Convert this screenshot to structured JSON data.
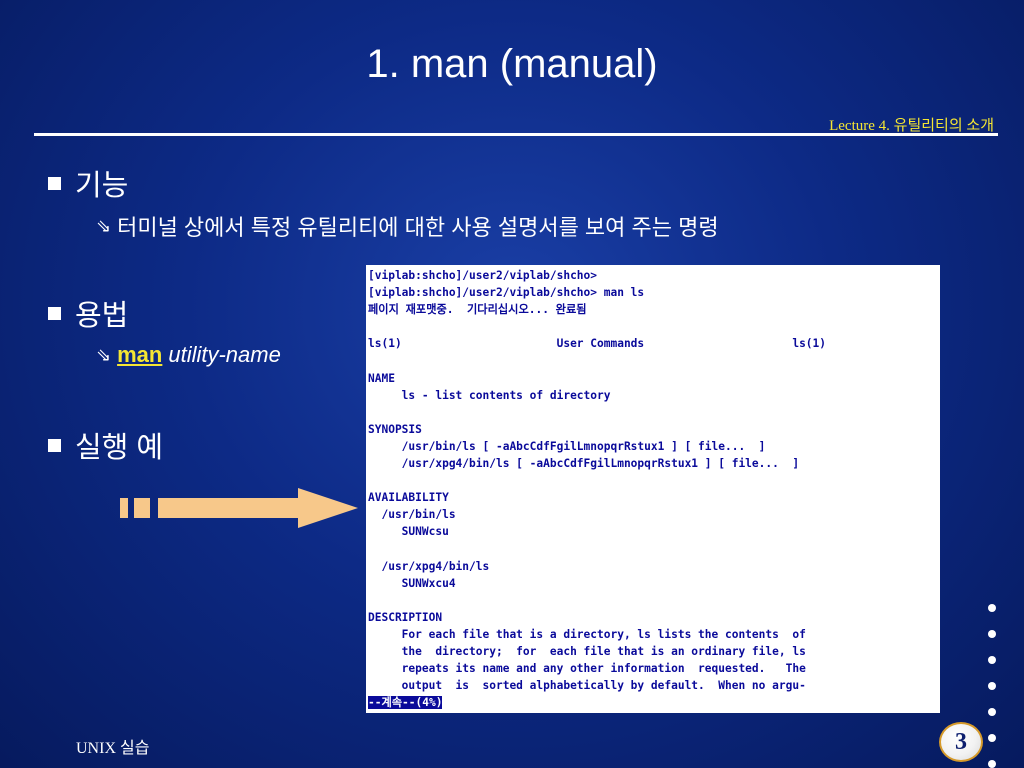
{
  "slide": {
    "title": "1. man (manual)",
    "subtitle": "Lecture 4. 유틸리티의 소개",
    "footer": "UNIX 실습",
    "page_number": "3"
  },
  "bullets": [
    {
      "label": "기능",
      "sub": "터미널 상에서 특정 유틸리티에 대한 사용 설명서를 보여 주는 명령"
    },
    {
      "label": "용법",
      "command": "man",
      "argument": "utility-name"
    },
    {
      "label": "실행 예"
    }
  ],
  "terminal": {
    "lines": [
      "[viplab:shcho]/user2/viplab/shcho>",
      "[viplab:shcho]/user2/viplab/shcho> man ls",
      "페이지 재포맷중.  기다리십시오... 완료됨",
      "",
      "ls(1)                       User Commands                      ls(1)",
      "",
      "NAME",
      "     ls - list contents of directory",
      "",
      "SYNOPSIS",
      "     /usr/bin/ls [ -aAbcCdfFgilLmnopqrRstux1 ] [ file...  ]",
      "     /usr/xpg4/bin/ls [ -aAbcCdfFgilLmnopqrRstux1 ] [ file...  ]",
      "",
      "AVAILABILITY",
      "  /usr/bin/ls",
      "     SUNWcsu",
      "",
      "  /usr/xpg4/bin/ls",
      "     SUNWxcu4",
      "",
      "DESCRIPTION",
      "     For each file that is a directory, ls lists the contents  of",
      "     the  directory;  for  each file that is an ordinary file, ls",
      "     repeats its name and any other information  requested.   The",
      "     output  is  sorted alphabetically by default.  When no argu-"
    ],
    "status": "--계속--(4%)"
  },
  "colors": {
    "background": "#0d2a86",
    "accent_yellow": "#f5e633",
    "arrow": "#f7c88a",
    "terminal_text": "#0a0a9a"
  },
  "icons": {
    "bullet": "square-bullet-icon",
    "sub_bullet": "hollow-arrow-icon",
    "pointer": "dashed-arrow-icon"
  }
}
